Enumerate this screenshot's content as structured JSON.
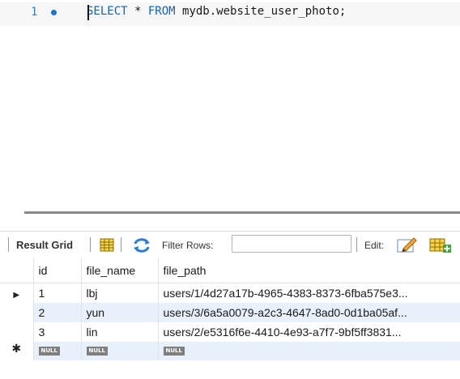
{
  "editor": {
    "line_number": "1",
    "sql": {
      "kw_select": "SELECT",
      "mid": " * ",
      "kw_from": "FROM",
      "rest": " mydb.website_user_photo;"
    }
  },
  "toolbar": {
    "result_grid": "Result Grid",
    "filter_rows": "Filter Rows:",
    "filter_value": "",
    "edit": "Edit:"
  },
  "grid": {
    "columns": [
      "id",
      "file_name",
      "file_path"
    ],
    "rows": [
      [
        "1",
        "lbj",
        "users/1/4d27a17b-4965-4383-8373-6fba575e3..."
      ],
      [
        "2",
        "yun",
        "users/3/6a5a0079-a2c3-4647-8ad0-0d1ba05af..."
      ],
      [
        "3",
        "lin",
        "users/2/e5316f6e-4410-4e93-a7f7-9bf5ff3831..."
      ]
    ],
    "null_label": "NULL",
    "current_row_marker": "▶",
    "new_row_marker": "✱"
  },
  "colors": {
    "keyword": "#1462a8",
    "alt_row": "#e8f1fb",
    "null_badge": "#7f7f7f"
  }
}
